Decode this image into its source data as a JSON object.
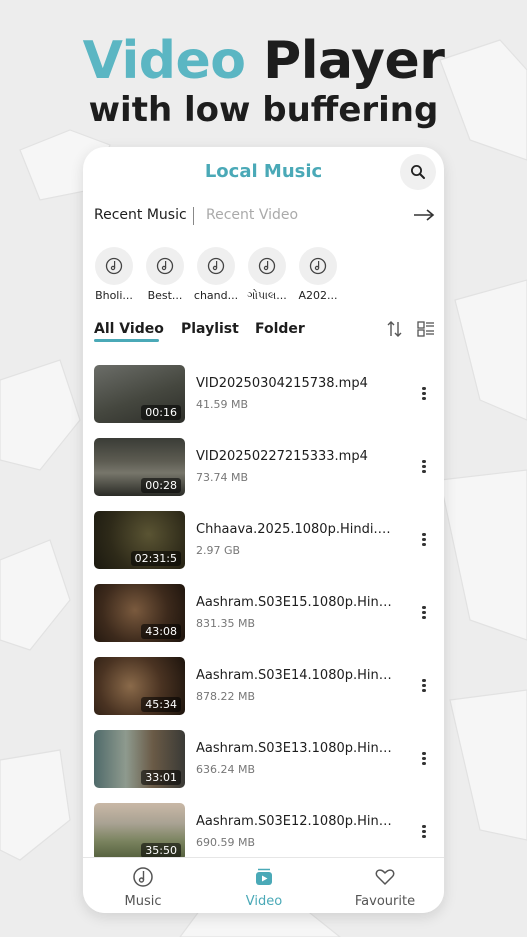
{
  "headline": {
    "accent": "Video",
    "rest": "Player",
    "subtitle": "with low buffering"
  },
  "appbar": {
    "title": "Local Music",
    "search_icon": "search-icon"
  },
  "recent": {
    "active_tab": "Recent Music",
    "inactive_tab": "Recent Video",
    "arrow_icon": "arrow-right-icon"
  },
  "recent_items": [
    {
      "label": "Bholi..."
    },
    {
      "label": "Best..."
    },
    {
      "label": "chand..."
    },
    {
      "label": "ગોપાલ..."
    },
    {
      "label": "A202..."
    }
  ],
  "tabs": {
    "all_video": "All Video",
    "playlist": "Playlist",
    "folder": "Folder"
  },
  "videos": [
    {
      "name": "VID20250304215738.mp4",
      "size": "41.59 MB",
      "duration": "00:16"
    },
    {
      "name": "VID20250227215333.mp4",
      "size": "73.74 MB",
      "duration": "00:28"
    },
    {
      "name": "Chhaava.2025.1080p.Hindi.W...",
      "size": "2.97 GB",
      "duration": "02:31:5"
    },
    {
      "name": "Aashram.S03E15.1080p.Hind...",
      "size": "831.35 MB",
      "duration": "43:08"
    },
    {
      "name": "Aashram.S03E14.1080p.Hind...",
      "size": "878.22 MB",
      "duration": "45:34"
    },
    {
      "name": "Aashram.S03E13.1080p.Hind...",
      "size": "636.24 MB",
      "duration": "33:01"
    },
    {
      "name": "Aashram.S03E12.1080p.Hind...",
      "size": "690.59 MB",
      "duration": "35:50"
    }
  ],
  "navbar": {
    "music": "Music",
    "video": "Video",
    "favourite": "Favourite"
  },
  "colors": {
    "accent": "#4aa9b7",
    "headline_accent": "#5bb6c3",
    "text": "#1d1d1d"
  }
}
